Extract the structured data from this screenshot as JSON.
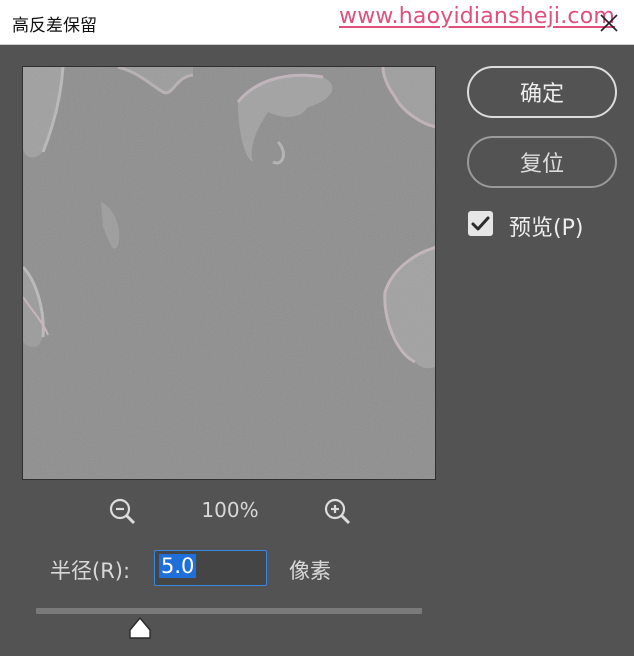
{
  "window": {
    "title": "高反差保留",
    "watermark": "www.haoyidiansheji.com",
    "close_icon": "close-icon"
  },
  "buttons": {
    "ok_label": "确定",
    "reset_label": "复位"
  },
  "preview_toggle": {
    "label": "预览(P)",
    "checked": true
  },
  "zoom": {
    "level": "100%",
    "zoom_out_icon": "zoom-out-icon",
    "zoom_in_icon": "zoom-in-icon"
  },
  "radius": {
    "label": "半径(R):",
    "value": "5.0",
    "unit": "像素",
    "slider_fraction": 0.27
  },
  "colors": {
    "dialog_bg": "#535353",
    "preview_gray": "#8f8f8f",
    "watermark": "#e0507a",
    "focus_blue": "#3a86e0"
  }
}
